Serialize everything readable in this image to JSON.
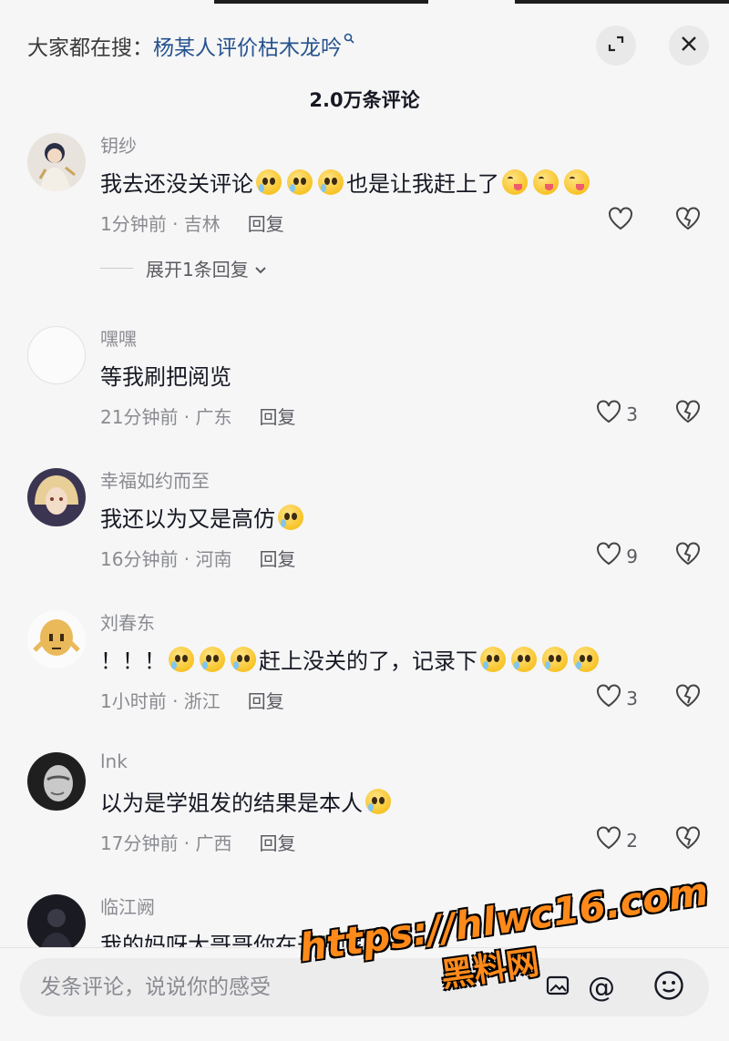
{
  "search": {
    "prefix": "大家都在搜：",
    "query": "杨某人评价枯木龙吟",
    "query_icon": "search-icon"
  },
  "header": {
    "count_title": "2.0万条评论"
  },
  "comments": [
    {
      "username": "钥纱",
      "text_before": "我去还没关评论",
      "text_after": "也是让我赶上了",
      "time_location": "1分钟前 · 吉林",
      "reply_label": "回复",
      "likes": "",
      "expand_label": "展开1条回复"
    },
    {
      "username": "嘿嘿",
      "text": "等我刷把阅览",
      "time_location": "21分钟前 · 广东",
      "reply_label": "回复",
      "likes": "3"
    },
    {
      "username": "幸福如约而至",
      "text": "我还以为又是高仿",
      "time_location": "16分钟前 · 河南",
      "reply_label": "回复",
      "likes": "9"
    },
    {
      "username": "刘春东",
      "text_before": "！！！",
      "text_mid": "赶上没关的了，记录下",
      "time_location": "1小时前 · 浙江",
      "reply_label": "回复",
      "likes": "3"
    },
    {
      "username": "lnk",
      "text": "以为是学姐发的结果是本人",
      "time_location": "17分钟前 · 广西",
      "reply_label": "回复",
      "likes": "2"
    },
    {
      "username": "临江阙",
      "text": "我的妈呀大哥哥你在干嘛呢"
    }
  ],
  "input": {
    "placeholder": "发条评论，说说你的感受"
  },
  "watermark": {
    "url": "https://hlwc16.com",
    "name": "黑料网"
  },
  "colors": {
    "background": "#f6f6f6",
    "query_link": "#26528f",
    "secondary_text": "#8a8b91",
    "watermark": "#ff8a1a"
  }
}
